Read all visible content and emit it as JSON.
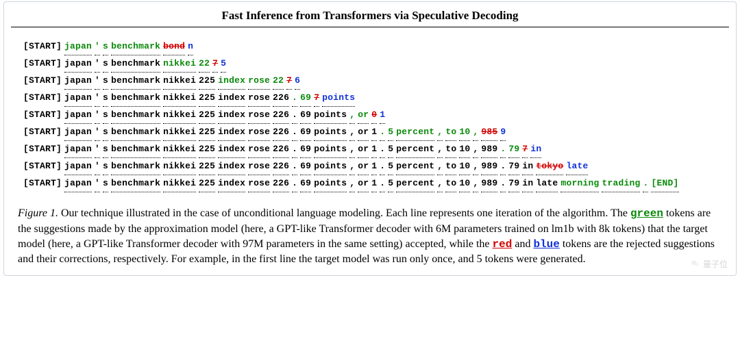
{
  "title": "Fast Inference from Transformers via Speculative Decoding",
  "watermark": "量子位",
  "rows": [
    [
      {
        "t": "[START]",
        "c": "black",
        "noUnd": true
      },
      {
        "t": "japan",
        "c": "green"
      },
      {
        "t": "'",
        "c": "green"
      },
      {
        "t": "s",
        "c": "green"
      },
      {
        "t": "benchmark",
        "c": "green"
      },
      {
        "t": "bond",
        "c": "red"
      },
      {
        "t": "n",
        "c": "blue"
      }
    ],
    [
      {
        "t": "[START]",
        "c": "black",
        "noUnd": true
      },
      {
        "t": "japan",
        "c": "black"
      },
      {
        "t": "'",
        "c": "black"
      },
      {
        "t": "s",
        "c": "black"
      },
      {
        "t": "benchmark",
        "c": "black"
      },
      {
        "t": "nikkei",
        "c": "green"
      },
      {
        "t": "22",
        "c": "green"
      },
      {
        "t": "7",
        "c": "red"
      },
      {
        "t": "5",
        "c": "blue"
      }
    ],
    [
      {
        "t": "[START]",
        "c": "black",
        "noUnd": true
      },
      {
        "t": "japan",
        "c": "black"
      },
      {
        "t": "'",
        "c": "black"
      },
      {
        "t": "s",
        "c": "black"
      },
      {
        "t": "benchmark",
        "c": "black"
      },
      {
        "t": "nikkei",
        "c": "black"
      },
      {
        "t": "225",
        "c": "black"
      },
      {
        "t": "index",
        "c": "green"
      },
      {
        "t": "rose",
        "c": "green"
      },
      {
        "t": "22",
        "c": "green"
      },
      {
        "t": "7",
        "c": "red"
      },
      {
        "t": "6",
        "c": "blue"
      }
    ],
    [
      {
        "t": "[START]",
        "c": "black",
        "noUnd": true
      },
      {
        "t": "japan",
        "c": "black"
      },
      {
        "t": "'",
        "c": "black"
      },
      {
        "t": "s",
        "c": "black"
      },
      {
        "t": "benchmark",
        "c": "black"
      },
      {
        "t": "nikkei",
        "c": "black"
      },
      {
        "t": "225",
        "c": "black"
      },
      {
        "t": "index",
        "c": "black"
      },
      {
        "t": "rose",
        "c": "black"
      },
      {
        "t": "226",
        "c": "black"
      },
      {
        "t": ".",
        "c": "green"
      },
      {
        "t": "69",
        "c": "green"
      },
      {
        "t": "7",
        "c": "red"
      },
      {
        "t": "points",
        "c": "blue"
      }
    ],
    [
      {
        "t": "[START]",
        "c": "black",
        "noUnd": true
      },
      {
        "t": "japan",
        "c": "black"
      },
      {
        "t": "'",
        "c": "black"
      },
      {
        "t": "s",
        "c": "black"
      },
      {
        "t": "benchmark",
        "c": "black"
      },
      {
        "t": "nikkei",
        "c": "black"
      },
      {
        "t": "225",
        "c": "black"
      },
      {
        "t": "index",
        "c": "black"
      },
      {
        "t": "rose",
        "c": "black"
      },
      {
        "t": "226",
        "c": "black"
      },
      {
        "t": ".",
        "c": "black"
      },
      {
        "t": "69",
        "c": "black"
      },
      {
        "t": "points",
        "c": "black"
      },
      {
        "t": ",",
        "c": "green"
      },
      {
        "t": "or",
        "c": "green"
      },
      {
        "t": "0",
        "c": "red"
      },
      {
        "t": "1",
        "c": "blue"
      }
    ],
    [
      {
        "t": "[START]",
        "c": "black",
        "noUnd": true
      },
      {
        "t": "japan",
        "c": "black"
      },
      {
        "t": "'",
        "c": "black"
      },
      {
        "t": "s",
        "c": "black"
      },
      {
        "t": "benchmark",
        "c": "black"
      },
      {
        "t": "nikkei",
        "c": "black"
      },
      {
        "t": "225",
        "c": "black"
      },
      {
        "t": "index",
        "c": "black"
      },
      {
        "t": "rose",
        "c": "black"
      },
      {
        "t": "226",
        "c": "black"
      },
      {
        "t": ".",
        "c": "black"
      },
      {
        "t": "69",
        "c": "black"
      },
      {
        "t": "points",
        "c": "black"
      },
      {
        "t": ",",
        "c": "black"
      },
      {
        "t": "or",
        "c": "black"
      },
      {
        "t": "1",
        "c": "black"
      },
      {
        "t": ".",
        "c": "green"
      },
      {
        "t": "5",
        "c": "green"
      },
      {
        "t": "percent",
        "c": "green"
      },
      {
        "t": ",",
        "c": "green"
      },
      {
        "t": "to",
        "c": "green"
      },
      {
        "t": "10",
        "c": "green"
      },
      {
        "t": ",",
        "c": "green"
      },
      {
        "t": "985",
        "c": "red"
      },
      {
        "t": "9",
        "c": "blue"
      }
    ],
    [
      {
        "t": "[START]",
        "c": "black",
        "noUnd": true
      },
      {
        "t": "japan",
        "c": "black"
      },
      {
        "t": "'",
        "c": "black"
      },
      {
        "t": "s",
        "c": "black"
      },
      {
        "t": "benchmark",
        "c": "black"
      },
      {
        "t": "nikkei",
        "c": "black"
      },
      {
        "t": "225",
        "c": "black"
      },
      {
        "t": "index",
        "c": "black"
      },
      {
        "t": "rose",
        "c": "black"
      },
      {
        "t": "226",
        "c": "black"
      },
      {
        "t": ".",
        "c": "black"
      },
      {
        "t": "69",
        "c": "black"
      },
      {
        "t": "points",
        "c": "black"
      },
      {
        "t": ",",
        "c": "black"
      },
      {
        "t": "or",
        "c": "black"
      },
      {
        "t": "1",
        "c": "black"
      },
      {
        "t": ".",
        "c": "black"
      },
      {
        "t": "5",
        "c": "black"
      },
      {
        "t": "percent",
        "c": "black"
      },
      {
        "t": ",",
        "c": "black"
      },
      {
        "t": "to",
        "c": "black"
      },
      {
        "t": "10",
        "c": "black"
      },
      {
        "t": ",",
        "c": "black"
      },
      {
        "t": "989",
        "c": "black"
      },
      {
        "t": ".",
        "c": "green"
      },
      {
        "t": "79",
        "c": "green"
      },
      {
        "t": "7",
        "c": "red"
      },
      {
        "t": "in",
        "c": "blue"
      }
    ],
    [
      {
        "t": "[START]",
        "c": "black",
        "noUnd": true
      },
      {
        "t": "japan",
        "c": "black"
      },
      {
        "t": "'",
        "c": "black"
      },
      {
        "t": "s",
        "c": "black"
      },
      {
        "t": "benchmark",
        "c": "black"
      },
      {
        "t": "nikkei",
        "c": "black"
      },
      {
        "t": "225",
        "c": "black"
      },
      {
        "t": "index",
        "c": "black"
      },
      {
        "t": "rose",
        "c": "black"
      },
      {
        "t": "226",
        "c": "black"
      },
      {
        "t": ".",
        "c": "black"
      },
      {
        "t": "69",
        "c": "black"
      },
      {
        "t": "points",
        "c": "black"
      },
      {
        "t": ",",
        "c": "black"
      },
      {
        "t": "or",
        "c": "black"
      },
      {
        "t": "1",
        "c": "black"
      },
      {
        "t": ".",
        "c": "black"
      },
      {
        "t": "5",
        "c": "black"
      },
      {
        "t": "percent",
        "c": "black"
      },
      {
        "t": ",",
        "c": "black"
      },
      {
        "t": "to",
        "c": "black"
      },
      {
        "t": "10",
        "c": "black"
      },
      {
        "t": ",",
        "c": "black"
      },
      {
        "t": "989",
        "c": "black"
      },
      {
        "t": ".",
        "c": "black"
      },
      {
        "t": "79",
        "c": "black"
      },
      {
        "t": "in",
        "c": "black"
      },
      {
        "t": "tokyo",
        "c": "red"
      },
      {
        "t": "late",
        "c": "blue"
      }
    ],
    [
      {
        "t": "[START]",
        "c": "black",
        "noUnd": true
      },
      {
        "t": "japan",
        "c": "black"
      },
      {
        "t": "'",
        "c": "black"
      },
      {
        "t": "s",
        "c": "black"
      },
      {
        "t": "benchmark",
        "c": "black"
      },
      {
        "t": "nikkei",
        "c": "black"
      },
      {
        "t": "225",
        "c": "black"
      },
      {
        "t": "index",
        "c": "black"
      },
      {
        "t": "rose",
        "c": "black"
      },
      {
        "t": "226",
        "c": "black"
      },
      {
        "t": ".",
        "c": "black"
      },
      {
        "t": "69",
        "c": "black"
      },
      {
        "t": "points",
        "c": "black"
      },
      {
        "t": ",",
        "c": "black"
      },
      {
        "t": "or",
        "c": "black"
      },
      {
        "t": "1",
        "c": "black"
      },
      {
        "t": ".",
        "c": "black"
      },
      {
        "t": "5",
        "c": "black"
      },
      {
        "t": "percent",
        "c": "black"
      },
      {
        "t": ",",
        "c": "black"
      },
      {
        "t": "to",
        "c": "black"
      },
      {
        "t": "10",
        "c": "black"
      },
      {
        "t": ",",
        "c": "black"
      },
      {
        "t": "989",
        "c": "black"
      },
      {
        "t": ".",
        "c": "black"
      },
      {
        "t": "79",
        "c": "black"
      },
      {
        "t": "in",
        "c": "black"
      },
      {
        "t": "late",
        "c": "black"
      },
      {
        "t": "morning",
        "c": "green"
      },
      {
        "t": "trading",
        "c": "green"
      },
      {
        "t": ".",
        "c": "green"
      },
      {
        "t": "[END]",
        "c": "green"
      }
    ]
  ],
  "caption": {
    "lead": "Figure 1.",
    "p1a": "Our technique illustrated in the case of unconditional language modeling. Each line represents one iteration of the algorithm. The ",
    "kw_green": "green",
    "p1b": " tokens are the suggestions made by the approximation model (here, a GPT-like Transformer decoder with 6M parameters trained on lm1b with 8k tokens) that the target model (here, a GPT-like Transformer decoder with 97M parameters in the same setting) accepted, while the ",
    "kw_red": "red",
    "p1c": " and ",
    "kw_blue": "blue",
    "p1d": " tokens are the rejected suggestions and their corrections, respectively. For example, in the first line the target model was run only once, and 5 tokens were generated."
  }
}
